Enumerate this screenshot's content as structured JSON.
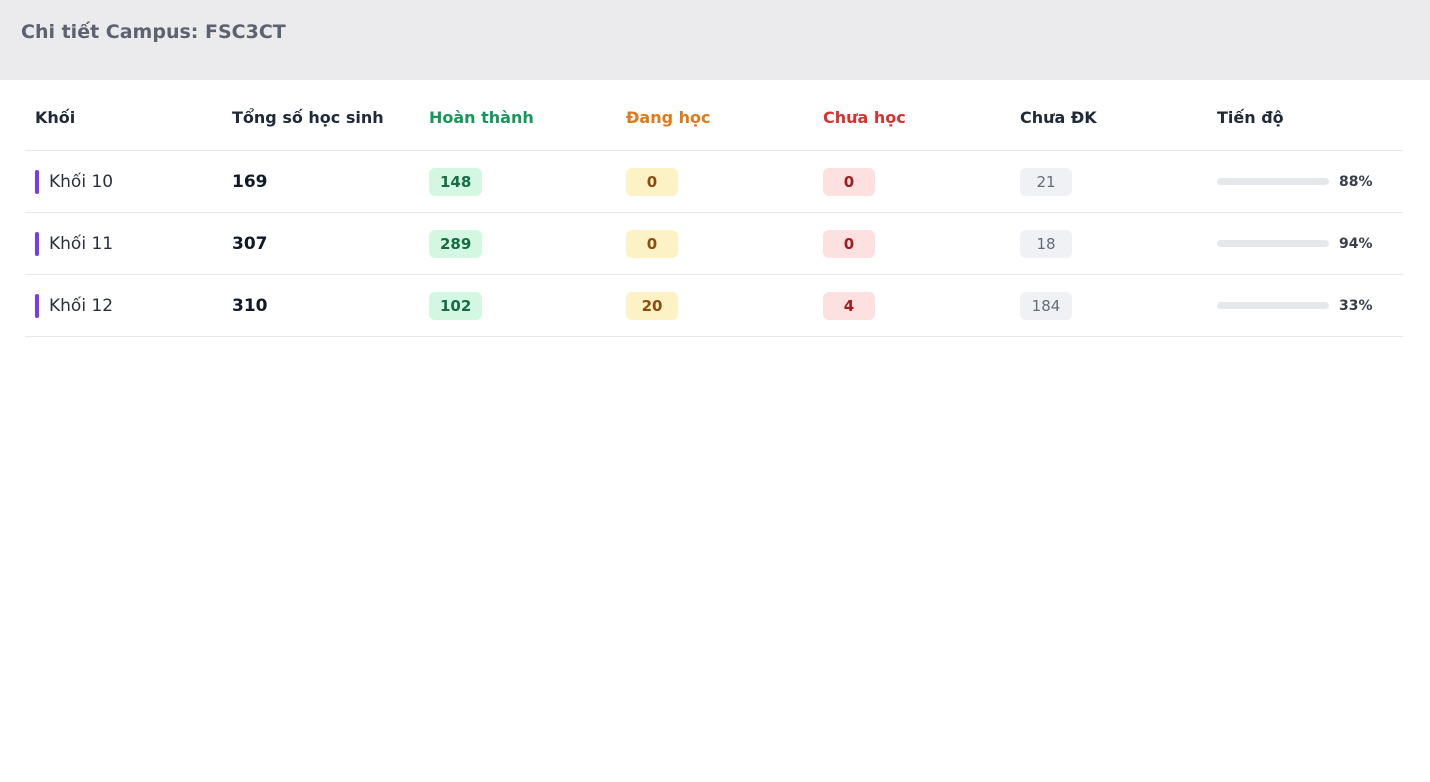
{
  "header": {
    "title": "Chi tiết Campus: FSC3CT"
  },
  "table": {
    "columns": [
      "Khối",
      "Tổng số học sinh",
      "Hoàn thành",
      "Đang học",
      "Chưa học",
      "Chưa ĐK",
      "Tiến độ"
    ],
    "rows": [
      {
        "grade": "Khối 10",
        "total": "169",
        "completed": "148",
        "studying": "0",
        "not_started": "0",
        "unregistered": "21",
        "progress": 0.88,
        "progress_label": "88%"
      },
      {
        "grade": "Khối 11",
        "total": "307",
        "completed": "289",
        "studying": "0",
        "not_started": "0",
        "unregistered": "18",
        "progress": 0.94,
        "progress_label": "94%"
      },
      {
        "grade": "Khối 12",
        "total": "310",
        "completed": "102",
        "studying": "20",
        "not_started": "4",
        "unregistered": "184",
        "progress": 0.33,
        "progress_label": "33%"
      }
    ]
  },
  "colors": {
    "grade_marker": "#7c3aed",
    "completed": "#16975a",
    "studying": "#e17a16",
    "not_started": "#dc2f2f",
    "progress_fill": "#f39c0c"
  }
}
